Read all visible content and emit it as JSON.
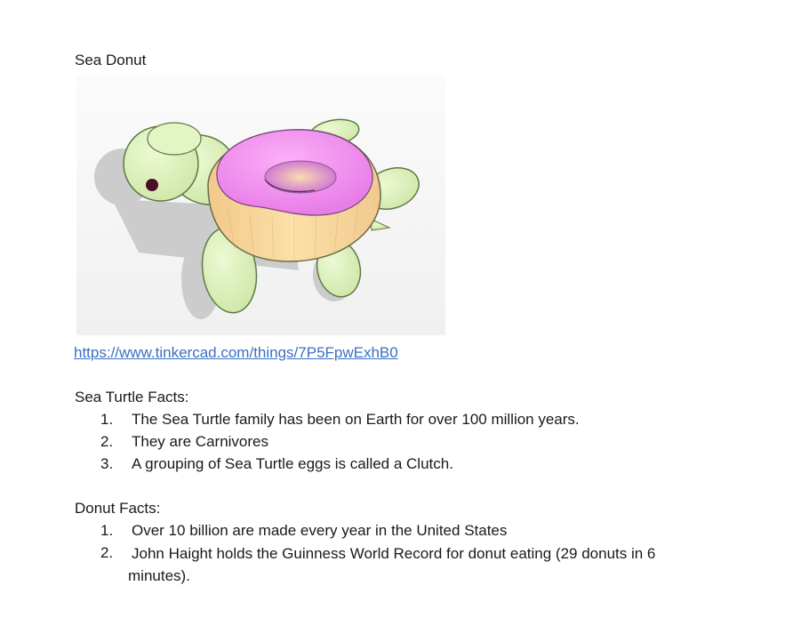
{
  "doc": {
    "title": "Sea Donut",
    "link": "https://www.tinkercad.com/things/7P5FpwExhB0",
    "image_alt": "3D model of a sea turtle with a donut shell",
    "sections": [
      {
        "heading": "Sea Turtle Facts:",
        "items": [
          {
            "num": "1.",
            "text": "The Sea Turtle family has been on Earth for over 100 million years."
          },
          {
            "num": "2.",
            "text": "They are Carnivores"
          },
          {
            "num": "3.",
            "text": "A grouping of Sea Turtle eggs is called a Clutch."
          }
        ]
      },
      {
        "heading": "Donut Facts:",
        "items": [
          {
            "num": "1.",
            "text": "Over 10 billion are made every year in the United States"
          },
          {
            "num": "2.",
            "text": "John Haight holds the Guinness World Record for donut eating (29 donuts in 6 minutes)."
          }
        ]
      }
    ]
  },
  "colors": {
    "link": "#3c6fc2",
    "turtle_body": "#ddf2b8",
    "turtle_outline": "#5d7a46",
    "donut_frosting": "#f08ff0",
    "donut_dough": "#f7d79a"
  }
}
